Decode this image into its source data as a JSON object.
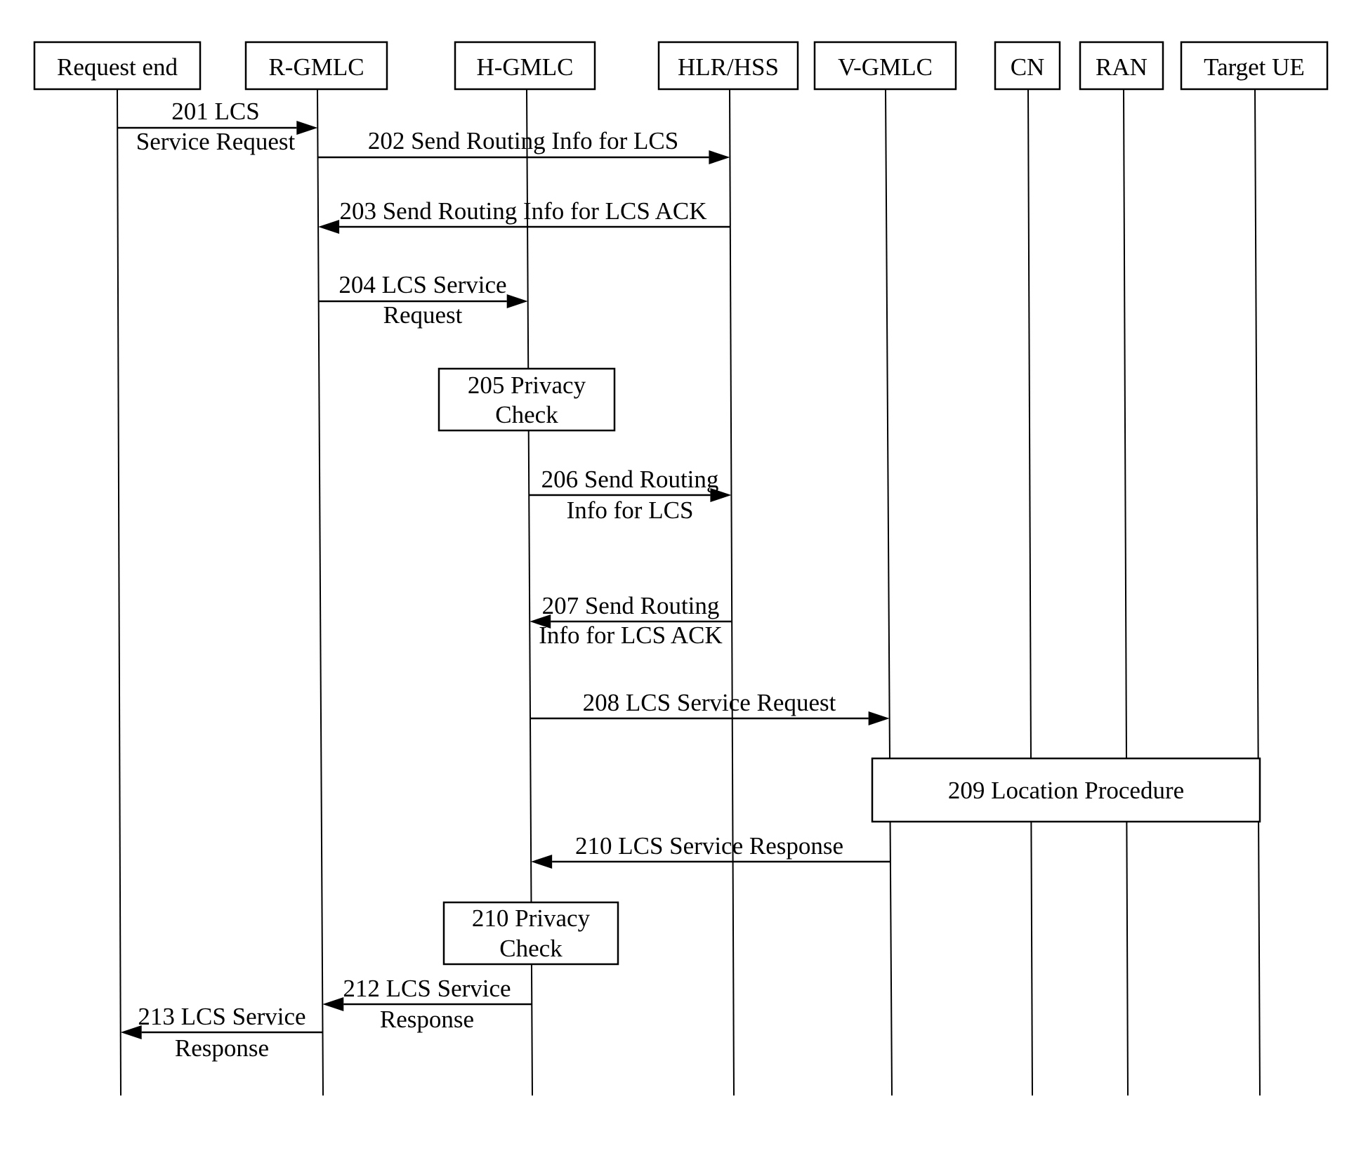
{
  "participants": [
    {
      "id": "req",
      "label": "Request end"
    },
    {
      "id": "rg",
      "label": "R-GMLC"
    },
    {
      "id": "hg",
      "label": "H-GMLC"
    },
    {
      "id": "hlr",
      "label": "HLR/HSS"
    },
    {
      "id": "vg",
      "label": "V-GMLC"
    },
    {
      "id": "cn",
      "label": "CN"
    },
    {
      "id": "ran",
      "label": "RAN"
    },
    {
      "id": "ue",
      "label": "Target UE"
    }
  ],
  "messages": [
    {
      "from": "req",
      "to": "rg",
      "lines": [
        "201 LCS",
        "Service Request"
      ]
    },
    {
      "from": "rg",
      "to": "hlr",
      "lines": [
        "202 Send Routing Info for LCS"
      ]
    },
    {
      "from": "hlr",
      "to": "rg",
      "lines": [
        "203 Send Routing Info for LCS ACK"
      ]
    },
    {
      "from": "rg",
      "to": "hg",
      "lines": [
        "204 LCS Service",
        "Request"
      ]
    },
    {
      "from": "hg",
      "to": "hlr",
      "lines": [
        "206 Send Routing",
        "Info for LCS"
      ]
    },
    {
      "from": "hlr",
      "to": "hg",
      "lines": [
        "207 Send Routing",
        "Info for LCS ACK"
      ]
    },
    {
      "from": "hg",
      "to": "vg",
      "lines": [
        "208 LCS Service Request"
      ]
    },
    {
      "from": "vg",
      "to": "hg",
      "lines": [
        "210 LCS Service Response"
      ]
    },
    {
      "from": "hg",
      "to": "rg",
      "lines": [
        "212 LCS Service",
        "Response"
      ]
    },
    {
      "from": "rg",
      "to": "req",
      "lines": [
        "213 LCS Service",
        "Response"
      ]
    }
  ],
  "process_boxes": [
    {
      "lines": [
        "205 Privacy",
        "Check"
      ]
    },
    {
      "lines": [
        "209 Location Procedure"
      ]
    },
    {
      "lines": [
        "210 Privacy",
        "Check"
      ]
    }
  ]
}
